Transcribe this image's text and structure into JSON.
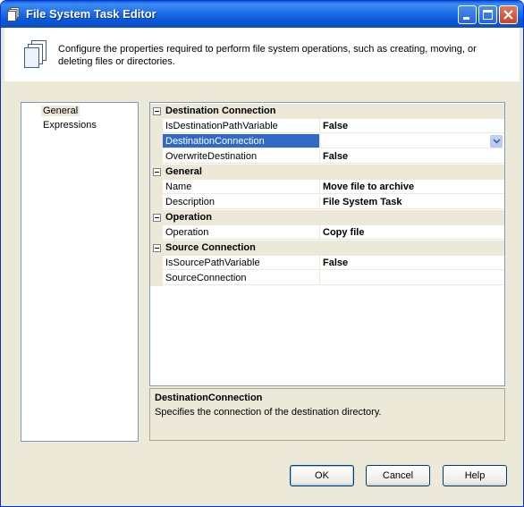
{
  "window": {
    "title": "File System Task Editor"
  },
  "header": {
    "description": "Configure the properties required to perform file system operations, such as creating, moving, or deleting files or directories."
  },
  "nav": {
    "items": [
      {
        "label": "General"
      },
      {
        "label": "Expressions"
      }
    ]
  },
  "grid": {
    "categories": [
      {
        "label": "Destination Connection",
        "props": [
          {
            "name": "IsDestinationPathVariable",
            "value": "False"
          },
          {
            "name": "DestinationConnection",
            "value": ""
          },
          {
            "name": "OverwriteDestination",
            "value": "False"
          }
        ]
      },
      {
        "label": "General",
        "props": [
          {
            "name": "Name",
            "value": "Move file to archive"
          },
          {
            "name": "Description",
            "value": "File System Task"
          }
        ]
      },
      {
        "label": "Operation",
        "props": [
          {
            "name": "Operation",
            "value": "Copy file"
          }
        ]
      },
      {
        "label": "Source Connection",
        "props": [
          {
            "name": "IsSourcePathVariable",
            "value": "False"
          },
          {
            "name": "SourceConnection",
            "value": ""
          }
        ]
      }
    ]
  },
  "description_panel": {
    "title": "DestinationConnection",
    "text": "Specifies the connection of the destination directory."
  },
  "buttons": {
    "ok": "OK",
    "cancel": "Cancel",
    "help": "Help"
  },
  "colors": {
    "selection": "#316ac5",
    "title_bar": "#0a5bd6",
    "face": "#ece9d8"
  },
  "icons": {
    "app": "document-stack-icon",
    "header": "document-stack-icon",
    "dropdown": "chevron-down-icon"
  }
}
